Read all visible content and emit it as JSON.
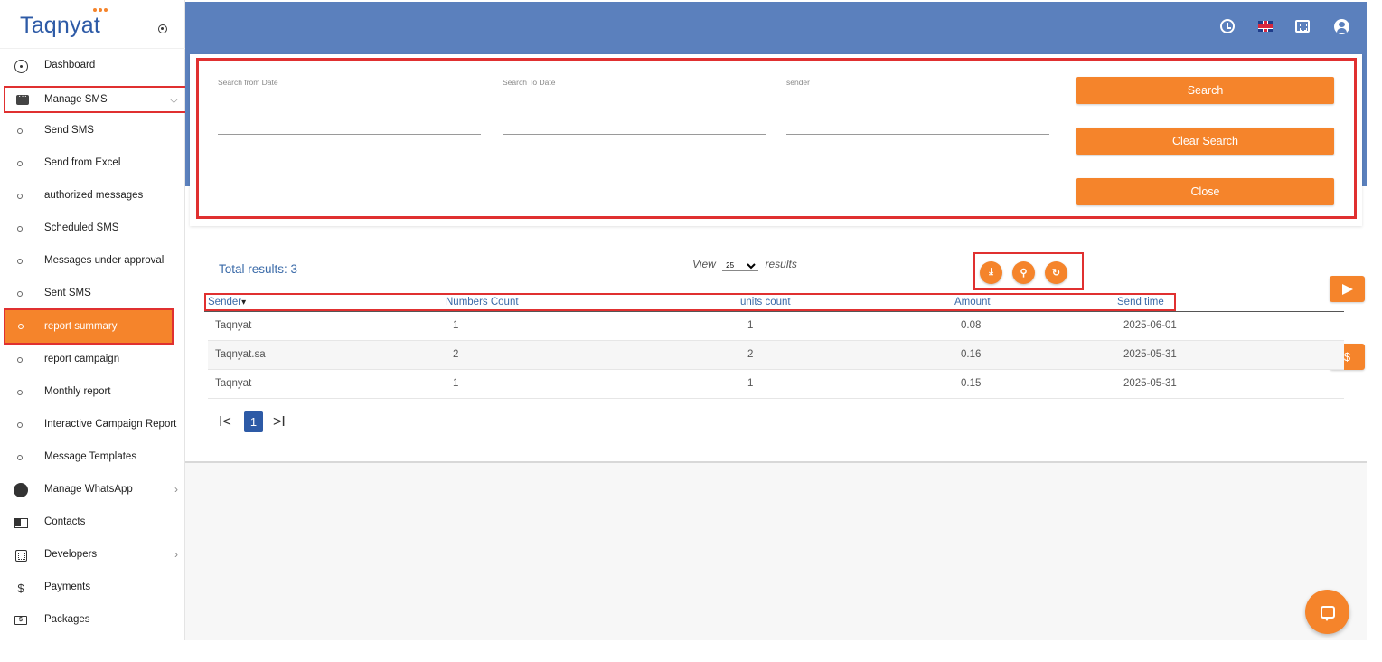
{
  "sidebar": {
    "logo": "Taqnyat",
    "items": [
      {
        "label": "Dashboard",
        "icon": "dashboard-icon"
      },
      {
        "label": "Manage SMS",
        "icon": "chat-icon"
      },
      {
        "label": "Send SMS"
      },
      {
        "label": "Send from Excel"
      },
      {
        "label": "authorized messages"
      },
      {
        "label": "Scheduled SMS"
      },
      {
        "label": "Messages under approval"
      },
      {
        "label": "Sent SMS"
      },
      {
        "label": "report summary"
      },
      {
        "label": "report campaign"
      },
      {
        "label": "Monthly report"
      },
      {
        "label": "Interactive Campaign Report"
      },
      {
        "label": "Message Templates"
      },
      {
        "label": "Manage WhatsApp",
        "icon": "whatsapp-icon"
      },
      {
        "label": "Contacts",
        "icon": "contacts-icon"
      },
      {
        "label": "Developers",
        "icon": "developers-icon"
      },
      {
        "label": "Payments",
        "icon": "dollar-icon"
      },
      {
        "label": "Packages",
        "icon": "packages-icon"
      }
    ]
  },
  "header": {
    "icons": [
      "clock-icon",
      "uk-flag-icon",
      "fullscreen-icon",
      "user-icon"
    ]
  },
  "search": {
    "from_label": "Search from Date",
    "to_label": "Search To Date",
    "sender_label": "sender",
    "from_value": "",
    "to_value": "",
    "sender_value": "",
    "search_btn": "Search",
    "clear_btn": "Clear Search",
    "close_btn": "Close"
  },
  "results": {
    "total_label": "Total results: 3",
    "view_prefix": "View",
    "view_value": "25",
    "view_suffix": "results",
    "columns": [
      "Sender",
      "Numbers Count",
      "units count",
      "Amount",
      "Send time"
    ],
    "sort_indicator": "▾",
    "rows": [
      {
        "sender": "Taqnyat",
        "numbers": "1",
        "units": "1",
        "amount": "0.08",
        "time": "2025-06-01"
      },
      {
        "sender": "Taqnyat.sa",
        "numbers": "2",
        "units": "2",
        "amount": "0.16",
        "time": "2025-05-31"
      },
      {
        "sender": "Taqnyat",
        "numbers": "1",
        "units": "1",
        "amount": "0.15",
        "time": "2025-05-31"
      }
    ],
    "pager": {
      "first": "I<",
      "page": "1",
      "last": ">I"
    }
  },
  "side_buttons": {
    "dollar": "$"
  },
  "colors": {
    "accent": "#f5842b",
    "header": "#5b80bd",
    "brand": "#2d5aa6",
    "highlight": "#e03030"
  }
}
